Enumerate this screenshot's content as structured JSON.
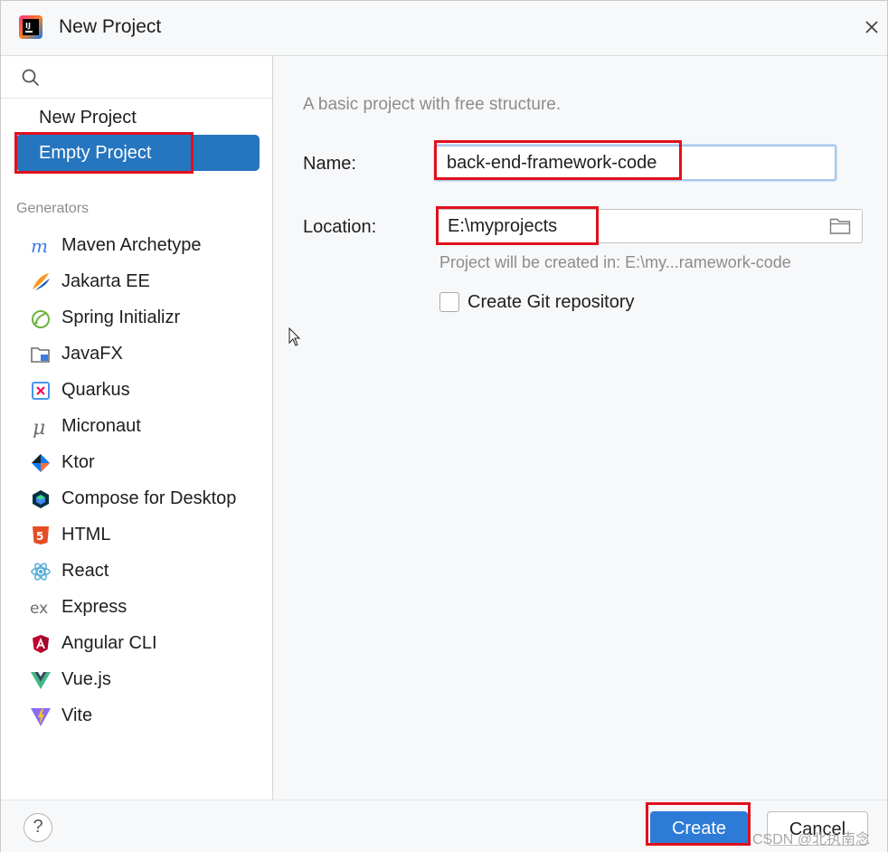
{
  "window": {
    "title": "New Project"
  },
  "sidebar": {
    "search_placeholder": "",
    "top_items": [
      {
        "label": "New Project",
        "selected": false
      },
      {
        "label": "Empty Project",
        "selected": true
      }
    ],
    "generators_heading": "Generators",
    "generators": [
      {
        "label": "Maven Archetype",
        "icon": "maven-icon"
      },
      {
        "label": "Jakarta EE",
        "icon": "jakarta-ee-icon"
      },
      {
        "label": "Spring Initializr",
        "icon": "spring-icon"
      },
      {
        "label": "JavaFX",
        "icon": "javafx-icon"
      },
      {
        "label": "Quarkus",
        "icon": "quarkus-icon"
      },
      {
        "label": "Micronaut",
        "icon": "micronaut-icon"
      },
      {
        "label": "Ktor",
        "icon": "ktor-icon"
      },
      {
        "label": "Compose for Desktop",
        "icon": "compose-icon"
      },
      {
        "label": "HTML",
        "icon": "html5-icon"
      },
      {
        "label": "React",
        "icon": "react-icon"
      },
      {
        "label": "Express",
        "icon": "express-icon"
      },
      {
        "label": "Angular CLI",
        "icon": "angular-icon"
      },
      {
        "label": "Vue.js",
        "icon": "vue-icon"
      },
      {
        "label": "Vite",
        "icon": "vite-icon"
      }
    ]
  },
  "main": {
    "description": "A basic project with free structure.",
    "name_label": "Name:",
    "name_value": "back-end-framework-code",
    "location_label": "Location:",
    "location_value": "E:\\myprojects",
    "location_hint": "Project will be created in: E:\\my...ramework-code",
    "git_checkbox_label": "Create Git repository",
    "git_checked": false
  },
  "footer": {
    "help_label": "?",
    "create_label": "Create",
    "cancel_label": "Cancel"
  },
  "watermark": "CSDN @北执南念",
  "colors": {
    "accent": "#2675bf",
    "highlight_box": "#e0101c",
    "background": "#f7f8fa"
  }
}
